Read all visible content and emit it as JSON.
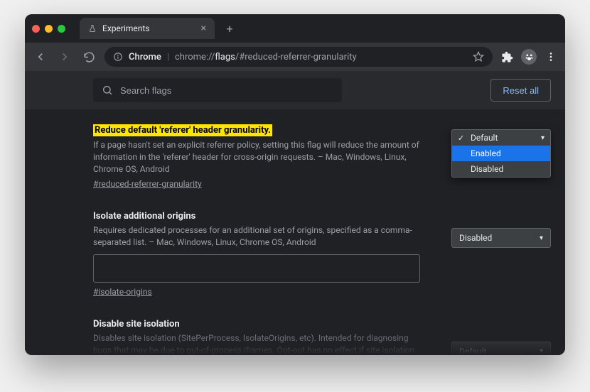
{
  "tab": {
    "title": "Experiments"
  },
  "omnibox": {
    "chip": "Chrome",
    "path_dim": "chrome://",
    "path_light": "flags",
    "path_tail": "/#reduced-referrer-granularity"
  },
  "search": {
    "placeholder": "Search flags"
  },
  "reset_label": "Reset all",
  "flags": [
    {
      "title": "Reduce default 'referer' header granularity.",
      "highlight": true,
      "desc": "If a page hasn't set an explicit referrer policy, setting this flag will reduce the amount of information in the 'referer' header for cross-origin requests. – Mac, Windows, Linux, Chrome OS, Android",
      "anchor": "#reduced-referrer-granularity",
      "dropdown": {
        "open": true,
        "current": "Default",
        "options": [
          "Default",
          "Enabled",
          "Disabled"
        ],
        "hovered": "Enabled"
      }
    },
    {
      "title": "Isolate additional origins",
      "highlight": false,
      "desc": "Requires dedicated processes for an additional set of origins, specified as a comma-separated list. – Mac, Windows, Linux, Chrome OS, Android",
      "anchor": "#isolate-origins",
      "input": true,
      "select_value": "Disabled"
    },
    {
      "title": "Disable site isolation",
      "highlight": false,
      "desc": "Disables site isolation (SitePerProcess, IsolateOrigins, etc). Intended for diagnosing bugs that may be due to out-of-process iframes. Opt-out has no effect if site isolation is force-enabled using a command line switch or using an enterprise policy. Caution: this disables",
      "select_value": "Default"
    }
  ]
}
